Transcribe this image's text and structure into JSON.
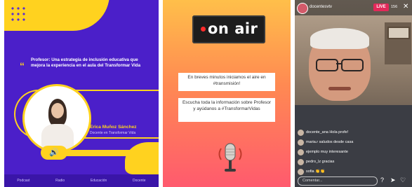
{
  "panel1": {
    "quote_text": "Profesor: Una estrategia de inclusión educativa que mejora la experiencia en el aula del Transformar Vida",
    "speaker_name": "Erica Muñoz Sánchez",
    "speaker_role": "Docente en Transformar Vida",
    "footer_items": [
      "Podcast",
      "Radio",
      "Educación",
      "Docente"
    ],
    "accent_color": "#ffd21f",
    "background_color": "#4b1fc9"
  },
  "panel2": {
    "on_air_label": "on air",
    "box1_text": "En breves minutos iniciamos el aire en #transmisión!",
    "box2_text": "Escucha toda la información sobre Profesor y ayúdanos a #TransformarVidas",
    "mic_icon": "microphone-icon"
  },
  "panel3": {
    "handle": "docentesvtv",
    "live_label": "LIVE",
    "viewers": "156",
    "comments": [
      "docente_ana Hola profe!",
      "maria.r  saludos desde casa",
      "ejemplo  muy interesante",
      "pedro_lz  gracias",
      "sofia  👏👏"
    ],
    "input_placeholder": "Comentar..."
  }
}
